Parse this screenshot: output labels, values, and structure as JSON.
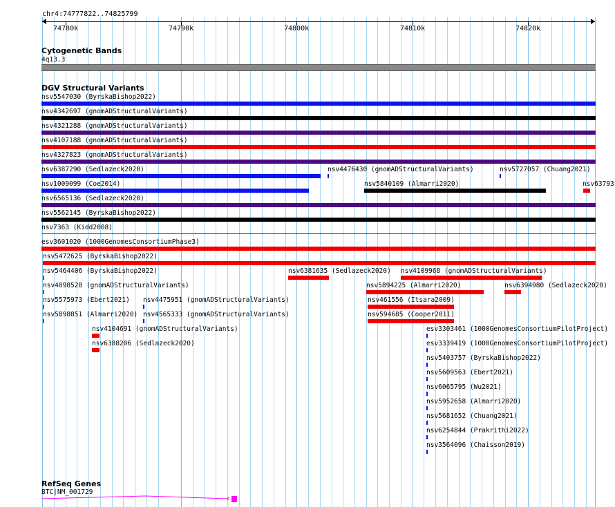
{
  "location": "chr4:74777822..74825799",
  "ruler_ticks": [
    "74780k",
    "74790k",
    "74800k",
    "74810k",
    "74820k"
  ],
  "tracks": {
    "cytoband": {
      "title": "Cytogenetic Bands",
      "band": "4q13.3"
    },
    "dgv": {
      "title": "DGV Structural Variants"
    },
    "refseq": {
      "title": "RefSeq Genes",
      "gene": "BTC|NM_001729"
    }
  },
  "colors": {
    "blue": "#0a14f0",
    "black": "#000000",
    "purple": "#4b0a82",
    "red": "#f00000",
    "magenta": "#ff00ff",
    "band_gray": "#888888",
    "grid": "#a8d8f0"
  },
  "features": [
    {
      "id": "nsv5547030",
      "label": "nsv5547030 (ByrskaBishop2022)"
    },
    {
      "id": "nsv4342697",
      "label": "nsv4342697 (gnomADStructuralVariants)"
    },
    {
      "id": "nsv4321288",
      "label": "nsv4321288 (gnomADStructuralVariants)"
    },
    {
      "id": "nsv4107188",
      "label": "nsv4107188 (gnomADStructuralVariants)"
    },
    {
      "id": "nsv4327823",
      "label": "nsv4327823 (gnomADStructuralVariants)"
    },
    {
      "id": "nsv6387290",
      "label": "nsv6387290 (Sedlazeck2020)"
    },
    {
      "id": "nsv4476430",
      "label": "nsv4476430 (gnomADStructuralVariants)"
    },
    {
      "id": "nsv5727057",
      "label": "nsv5727057 (Chuang2021)"
    },
    {
      "id": "nsv1009099",
      "label": "nsv1009099 (Coe2014)"
    },
    {
      "id": "nsv5840109",
      "label": "nsv5840109 (Almarri2020)"
    },
    {
      "id": "nsv63793",
      "label": "nsv63793"
    },
    {
      "id": "nsv6565136",
      "label": "nsv6565136 (Sedlazeck2020)"
    },
    {
      "id": "nsv5562145",
      "label": "nsv5562145 (ByrskaBishop2022)"
    },
    {
      "id": "nsv7363",
      "label": "nsv7363 (Kidd2008)"
    },
    {
      "id": "esv3601020",
      "label": "esv3601020 (1000GenomesConsortiumPhase3)"
    },
    {
      "id": "nsv5472625",
      "label": "nsv5472625 (ByrskaBishop2022)"
    },
    {
      "id": "nsv5464406",
      "label": "nsv5464406 (ByrskaBishop2022)"
    },
    {
      "id": "nsv6381635",
      "label": "nsv6381635 (Sedlazeck2020)"
    },
    {
      "id": "nsv4109968",
      "label": "nsv4109968 (gnomADStructuralVariants)"
    },
    {
      "id": "nsv4098528",
      "label": "nsv4098528 (gnomADStructuralVariants)"
    },
    {
      "id": "nsv5894225",
      "label": "nsv5894225 (Almarri2020)"
    },
    {
      "id": "nsv6394980",
      "label": "nsv6394980 (Sedlazeck2020)"
    },
    {
      "id": "nsv5575973",
      "label": "nsv5575973 (Ebert2021)"
    },
    {
      "id": "nsv4475951",
      "label": "nsv4475951 (gnomADStructuralVariants)"
    },
    {
      "id": "nsv461556",
      "label": "nsv461556 (Itsara2009)"
    },
    {
      "id": "nsv5898851",
      "label": "nsv5898851 (Almarri2020)"
    },
    {
      "id": "nsv4565333",
      "label": "nsv4565333 (gnomADStructuralVariants)"
    },
    {
      "id": "nsv594685",
      "label": "nsv594685 (Cooper2011)"
    },
    {
      "id": "nsv4104691",
      "label": "nsv4104691 (gnomADStructuralVariants)"
    },
    {
      "id": "esv3303461",
      "label": "esv3303461 (1000GenomesConsortiumPilotProject)"
    },
    {
      "id": "nsv6388206",
      "label": "nsv6388206 (Sedlazeck2020)"
    },
    {
      "id": "esv3339419",
      "label": "esv3339419 (1000GenomesConsortiumPilotProject)"
    },
    {
      "id": "nsv5403757",
      "label": "nsv5403757 (ByrskaBishop2022)"
    },
    {
      "id": "nsv5609563",
      "label": "nsv5609563 (Ebert2021)"
    },
    {
      "id": "nsv6065795",
      "label": "nsv6065795 (Wu2021)"
    },
    {
      "id": "nsv5952658",
      "label": "nsv5952658 (Almarri2020)"
    },
    {
      "id": "nsv5681652",
      "label": "nsv5681652 (Chuang2021)"
    },
    {
      "id": "nsv6254844",
      "label": "nsv6254844 (Prakrithi2022)"
    },
    {
      "id": "nsv3564096",
      "label": "nsv3564096 (Chaisson2019)"
    }
  ]
}
